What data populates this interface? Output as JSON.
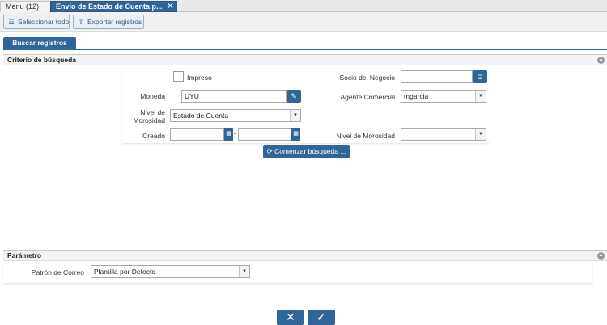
{
  "window_tabs": [
    {
      "label": "Menu (12)"
    },
    {
      "label": "Envío de Estado de Cuenta p..."
    }
  ],
  "toolbar": {
    "select_all_label": "Seleccionar todo",
    "export_label": "Exportar registros"
  },
  "search_tab": {
    "label": "Buscar registros"
  },
  "criteria": {
    "title": "Criterio de búsqueda",
    "impreso_label": "Impreso",
    "moneda_label": "Moneda",
    "moneda_value": "UYU",
    "nivel_label": "Nivel de Morosidad",
    "nivel_value": "Estado de Cuenta",
    "creado_label": "Creado",
    "creado_from": "",
    "creado_to": "",
    "range_separator": "-",
    "socio_label": "Socio del Negocio",
    "socio_value": "",
    "agente_label": "Agente Comercial",
    "agente_value": "mgarcia",
    "nivel2_label": "Nivel de Morosidad",
    "nivel2_value": "",
    "search_button_label": "Comenzar búsqueda ..."
  },
  "parameters": {
    "title": "Parámetro",
    "patron_label": "Patrón de Correo",
    "patron_value": "Plantilla por Defecto"
  },
  "colors": {
    "accent": "#2f6599",
    "panel_header": "#f3f3f3"
  }
}
